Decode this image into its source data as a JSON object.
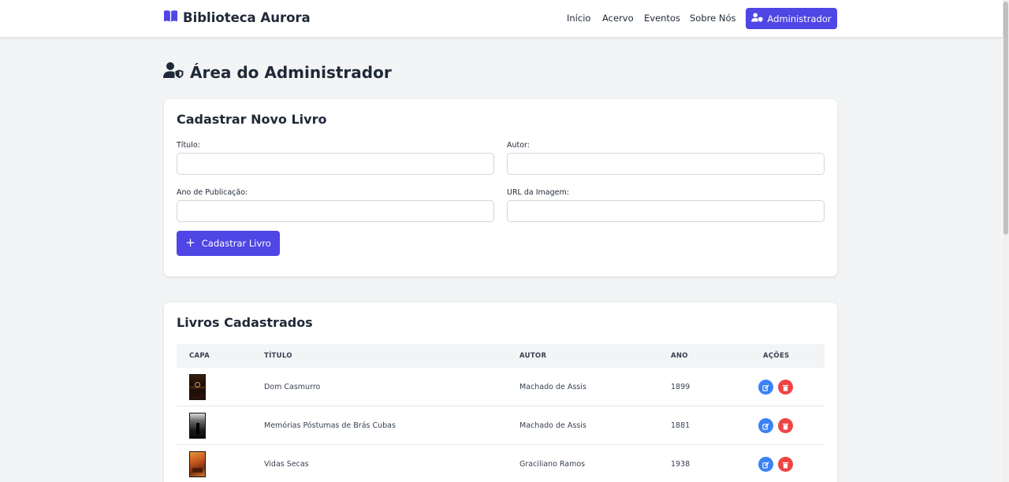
{
  "navbar": {
    "brand": "Biblioteca Aurora",
    "links": [
      "Início",
      "Acervo",
      "Eventos",
      "Sobre Nós"
    ],
    "admin_label": "Administrador"
  },
  "page": {
    "title": "Área do Administrador"
  },
  "form": {
    "title": "Cadastrar Novo Livro",
    "fields": {
      "titulo": {
        "label": "Título:",
        "value": ""
      },
      "autor": {
        "label": "Autor:",
        "value": ""
      },
      "ano": {
        "label": "Ano de Publicação:",
        "value": ""
      },
      "url": {
        "label": "URL da Imagem:",
        "value": ""
      }
    },
    "submit_label": "Cadastrar Livro"
  },
  "list": {
    "title": "Livros Cadastrados",
    "headers": [
      "CAPA",
      "TÍTULO",
      "AUTOR",
      "ANO",
      "AÇÕES"
    ],
    "rows": [
      {
        "titulo": "Dom Casmurro",
        "autor": "Machado de Assis",
        "ano": "1899"
      },
      {
        "titulo": "Memórias Póstumas de Brás Cubas",
        "autor": "Machado de Assis",
        "ano": "1881"
      },
      {
        "titulo": "Vidas Secas",
        "autor": "Graciliano Ramos",
        "ano": "1938"
      }
    ]
  },
  "colors": {
    "primary": "#4f46e5",
    "edit": "#3b82f6",
    "delete": "#ef4444",
    "background": "#f3f4f6"
  },
  "icons": {
    "brand": "book-open-icon",
    "admin": "user-shield-icon",
    "edit": "edit-icon",
    "delete": "trash-icon"
  }
}
